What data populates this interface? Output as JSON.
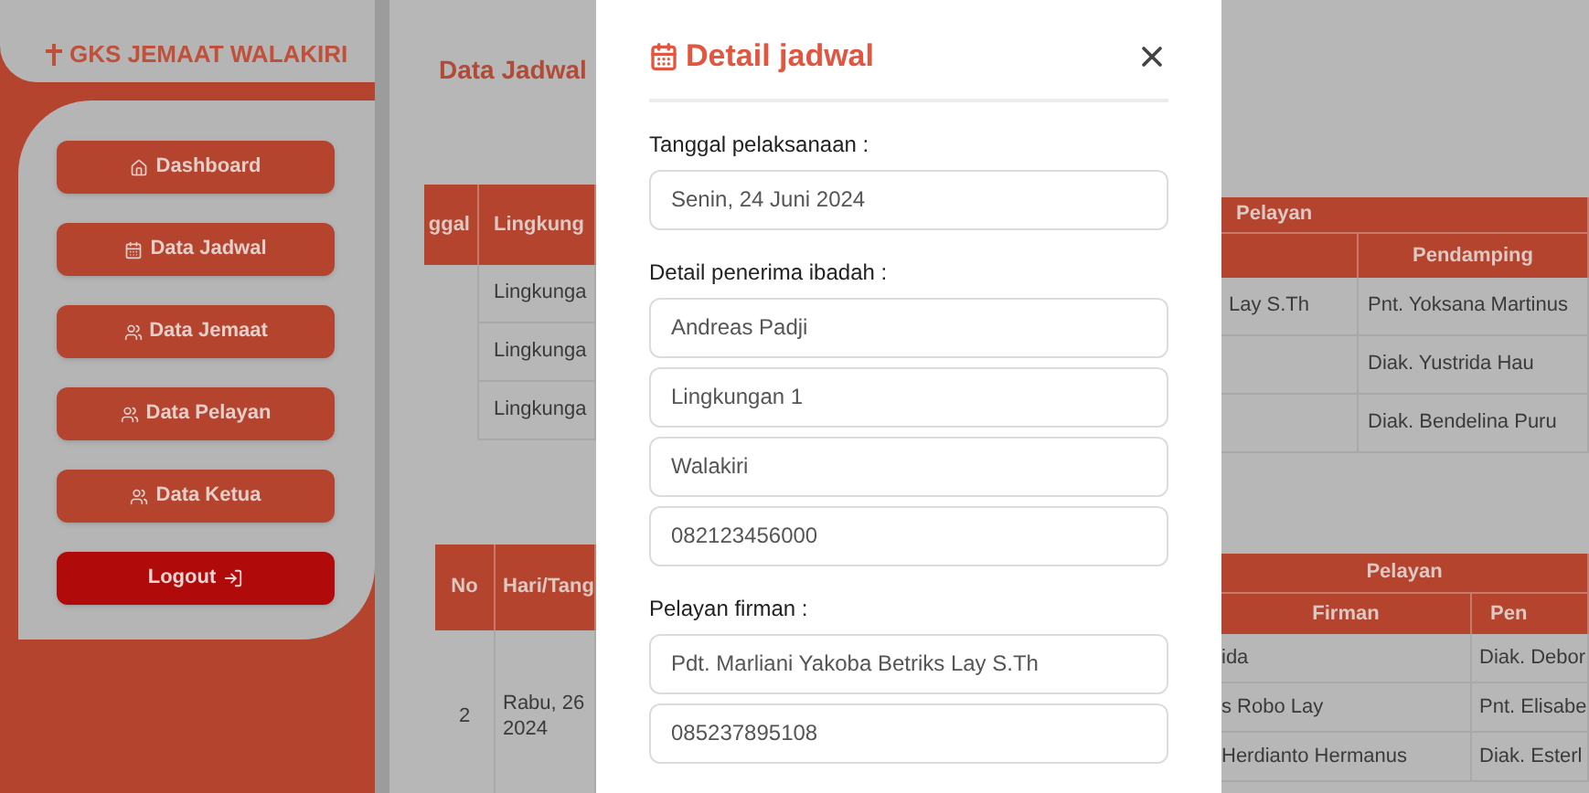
{
  "sidebar": {
    "title": "GKS JEMAAT WALAKIRI",
    "items": [
      {
        "label": "Dashboard",
        "kind": "nav"
      },
      {
        "label": "Data Jadwal",
        "kind": "nav"
      },
      {
        "label": "Data Jemaat",
        "kind": "nav"
      },
      {
        "label": "Data Pelayan",
        "kind": "nav"
      },
      {
        "label": "Data Ketua",
        "kind": "nav"
      },
      {
        "label": "Logout",
        "kind": "logout"
      }
    ]
  },
  "main": {
    "title": "Data Jadwal",
    "table_top": {
      "left": {
        "columns": [
          "ggal",
          "Lingkung"
        ],
        "rows": [
          {
            "column_2": "Lingkunga"
          },
          {
            "column_2": "Lingkunga"
          },
          {
            "column_2": "Lingkunga"
          }
        ]
      },
      "right": {
        "group_header": "Pelayan",
        "columns": [
          "Pendamping"
        ],
        "rows": [
          {
            "column_1": "Lay S.Th",
            "pendamping": "Pnt. Yoksana Martinus"
          },
          {
            "pendamping": "Diak. Yustrida Hau"
          },
          {
            "pendamping": "Diak. Bendelina Puru"
          }
        ]
      }
    },
    "table_bottom": {
      "left": {
        "columns": [
          "No",
          "Hari/Tang"
        ],
        "rows": [
          {
            "no": "2",
            "hari_tanggal": "Rabu, 26 2024"
          }
        ]
      },
      "right": {
        "group_header": "Pelayan",
        "columns": [
          "Firman",
          "Pen"
        ],
        "rows": [
          {
            "firman": "ida",
            "column_2": "Diak. Debor"
          },
          {
            "firman": "s Robo Lay",
            "column_2": "Pnt. Elisabe"
          },
          {
            "firman": "Herdianto Hermanus",
            "column_2": "Diak. Esterl"
          }
        ]
      }
    }
  },
  "modal": {
    "title": "Detail jadwal",
    "sections": [
      {
        "label": "Tanggal pelaksanaan :",
        "fields": [
          "Senin, 24 Juni 2024"
        ]
      },
      {
        "label": "Detail penerima ibadah :",
        "fields": [
          "Andreas Padji",
          "Lingkungan 1",
          "Walakiri",
          "082123456000"
        ]
      },
      {
        "label": "Pelayan firman :",
        "fields": [
          "Pdt. Marliani Yakoba Betriks Lay S.Th",
          "085237895108"
        ]
      }
    ]
  }
}
